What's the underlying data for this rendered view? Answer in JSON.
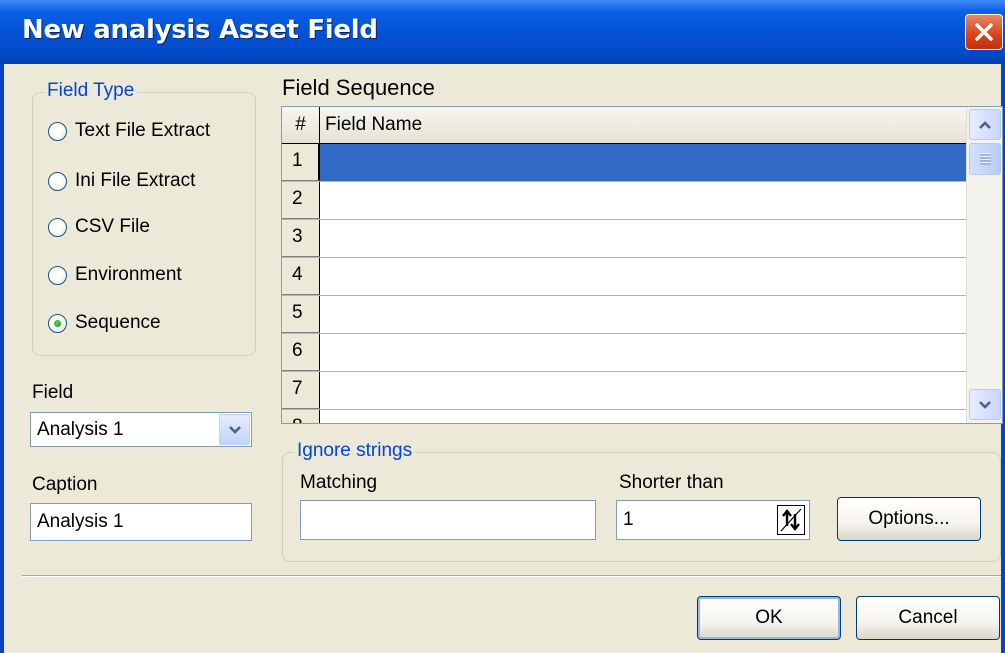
{
  "window": {
    "title": "New analysis Asset Field"
  },
  "field_type": {
    "legend": "Field Type",
    "options": [
      {
        "label": "Text File Extract",
        "checked": false
      },
      {
        "label": "Ini File Extract",
        "checked": false
      },
      {
        "label": "CSV File",
        "checked": false
      },
      {
        "label": "Environment",
        "checked": false
      },
      {
        "label": "Sequence",
        "checked": true
      }
    ]
  },
  "field": {
    "label": "Field",
    "value": "Analysis 1"
  },
  "caption": {
    "label": "Caption",
    "value": "Analysis 1"
  },
  "sequence": {
    "title": "Field Sequence",
    "columns": [
      "#",
      "Field Name"
    ],
    "rows": [
      {
        "num": "1",
        "name": "",
        "selected": true
      },
      {
        "num": "2",
        "name": ""
      },
      {
        "num": "3",
        "name": ""
      },
      {
        "num": "4",
        "name": ""
      },
      {
        "num": "5",
        "name": ""
      },
      {
        "num": "6",
        "name": ""
      },
      {
        "num": "7",
        "name": ""
      },
      {
        "num": "8",
        "name": ""
      }
    ]
  },
  "ignore": {
    "legend": "Ignore strings",
    "matching_label": "Matching",
    "matching_value": "",
    "shorter_label": "Shorter than",
    "shorter_value": "1",
    "options_label": "Options..."
  },
  "buttons": {
    "ok": "OK",
    "cancel": "Cancel"
  },
  "colors": {
    "title_bar": "#0453d6",
    "selection": "#316ac5",
    "legend_text": "#0046d5",
    "dialog_bg": "#ece9d8"
  },
  "icons": [
    "close-icon",
    "combo-dropdown-arrow-icon",
    "scroll-up-icon",
    "scroll-down-icon",
    "spin-up-down-icon"
  ]
}
